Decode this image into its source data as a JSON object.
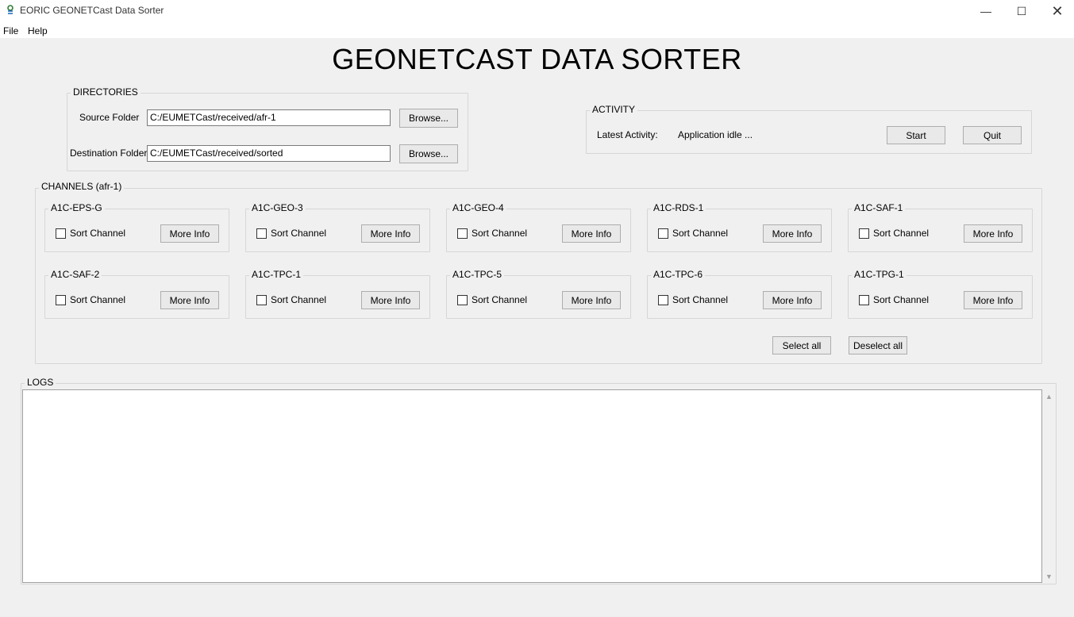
{
  "window": {
    "title": "EORIC GEONETCast Data Sorter",
    "controls": {
      "minimize": "—",
      "maximize": "☐",
      "close": "✕"
    }
  },
  "menu": {
    "file": "File",
    "help": "Help"
  },
  "heading": "GEONETCAST DATA SORTER",
  "directories": {
    "label": "DIRECTORIES",
    "source_label": "Source Folder",
    "source_value": "C:/EUMETCast/received/afr-1",
    "destination_label": "Destination Folder",
    "destination_value": "C:/EUMETCast/received/sorted",
    "browse_label": "Browse..."
  },
  "activity": {
    "label": "ACTIVITY",
    "latest_label": "Latest Activity:",
    "latest_value": "Application idle ...",
    "start_label": "Start",
    "quit_label": "Quit"
  },
  "channels": {
    "label": "CHANNELS (afr-1)",
    "sort_label": "Sort Channel",
    "more_info_label": "More Info",
    "items": [
      {
        "name": "A1C-EPS-G",
        "checked": false
      },
      {
        "name": "A1C-GEO-3",
        "checked": false
      },
      {
        "name": "A1C-GEO-4",
        "checked": false
      },
      {
        "name": "A1C-RDS-1",
        "checked": false
      },
      {
        "name": "A1C-SAF-1",
        "checked": false
      },
      {
        "name": "A1C-SAF-2",
        "checked": false
      },
      {
        "name": "A1C-TPC-1",
        "checked": false
      },
      {
        "name": "A1C-TPC-5",
        "checked": false
      },
      {
        "name": "A1C-TPC-6",
        "checked": false
      },
      {
        "name": "A1C-TPG-1",
        "checked": false
      }
    ],
    "select_all_label": "Select all",
    "deselect_all_label": "Deselect all"
  },
  "logs": {
    "label": "LOGS",
    "content": ""
  }
}
